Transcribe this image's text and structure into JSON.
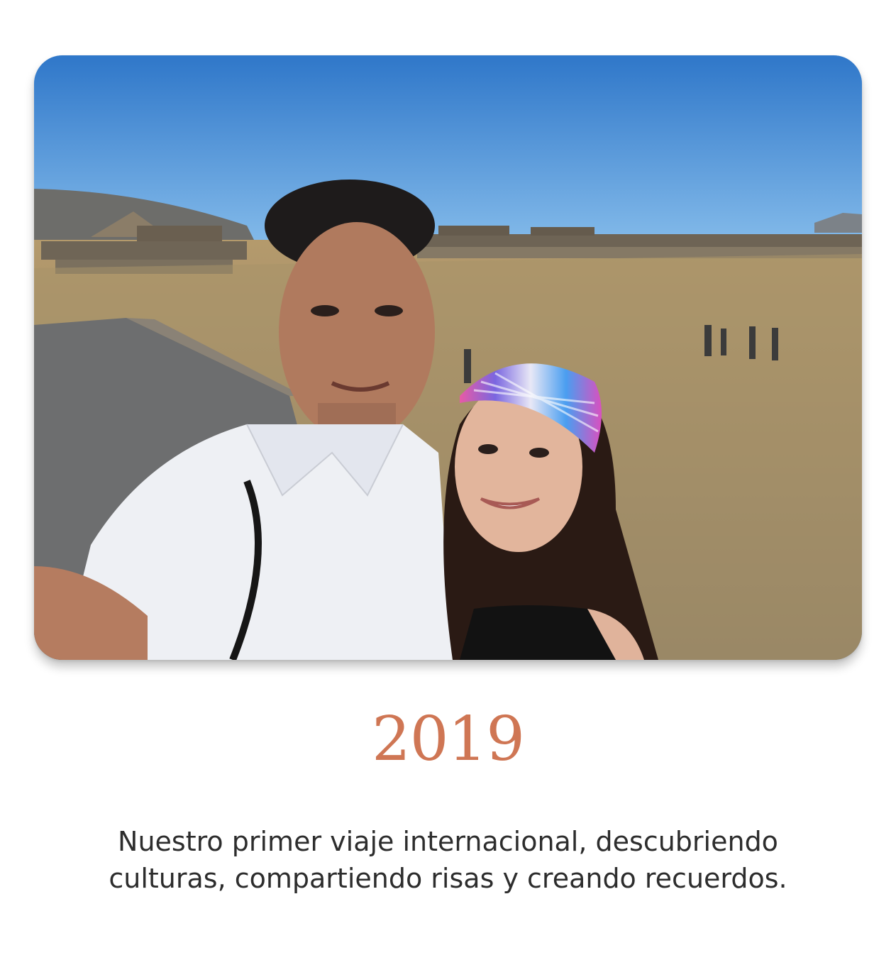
{
  "photo": {
    "alt": "Selfie de una pareja frente a las pirámides"
  },
  "year": "2019",
  "caption": "Nuestro primer viaje internacional, descubriendo culturas, compartiendo risas y creando recuerdos.",
  "colors": {
    "year": "#cf7654",
    "caption": "#2d2d2d",
    "background": "#ffffff"
  }
}
